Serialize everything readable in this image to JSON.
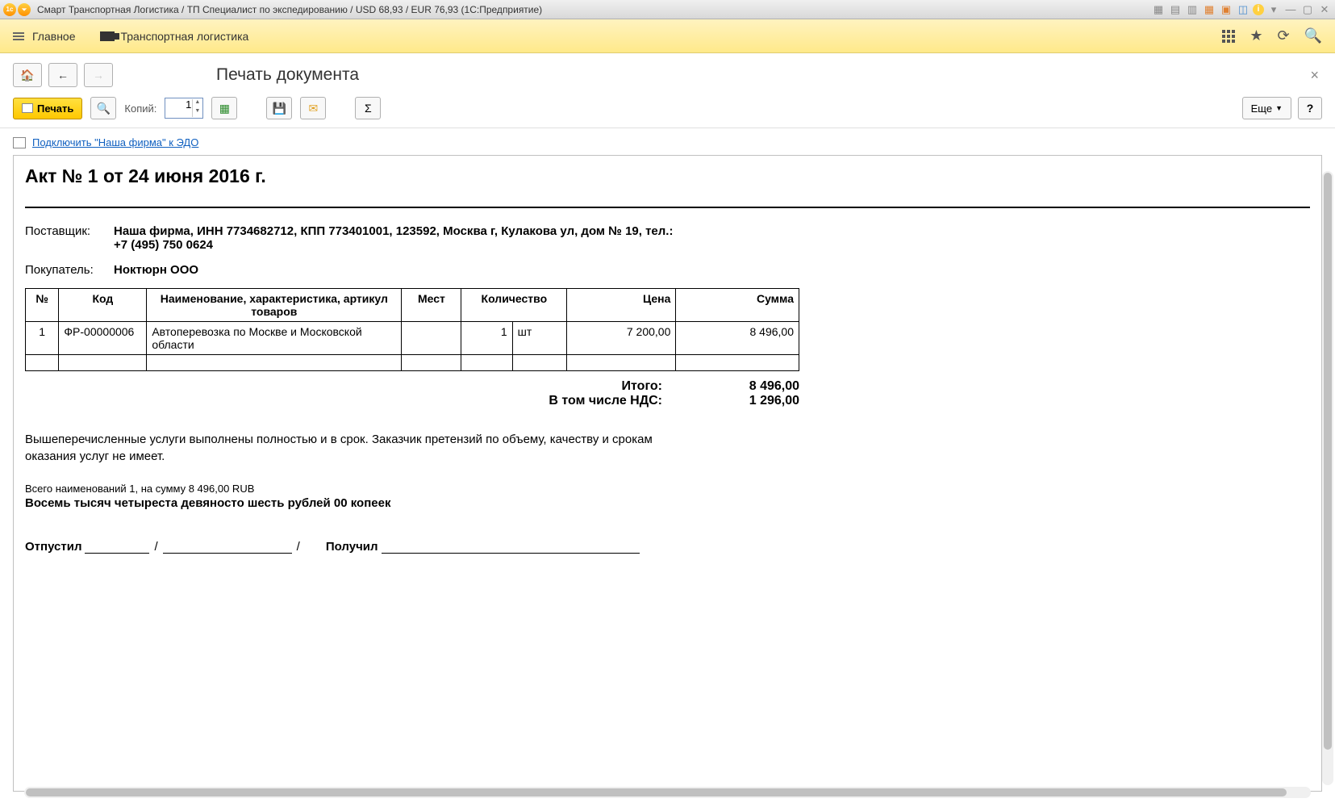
{
  "titlebar": {
    "text": "Смарт Транспортная Логистика / ТП Специалист по экспедированию / USD 68,93 / EUR 76,93  (1С:Предприятие)"
  },
  "menu": {
    "main": "Главное",
    "logistics": "Транспортная логистика"
  },
  "page": {
    "heading": "Печать документа"
  },
  "toolbar": {
    "print": "Печать",
    "copies_label": "Копий:",
    "copies_value": "1",
    "more": "Еще",
    "help": "?"
  },
  "edo": {
    "link": "Подключить \"Наша фирма\" к ЭДО"
  },
  "doc": {
    "title": "Акт № 1 от 24 июня 2016 г.",
    "supplier_label": "Поставщик:",
    "supplier_value": "Наша фирма,  ИНН 7734682712,  КПП 773401001,  123592, Москва г, Кулакова ул, дом № 19,  тел.: +7 (495) 750 0624",
    "buyer_label": "Покупатель:",
    "buyer_value": "Ноктюрн ООО",
    "table": {
      "headers": {
        "num": "№",
        "code": "Код",
        "name": "Наименование, характеристика, артикул товаров",
        "mest": "Мест",
        "qty": "Количество",
        "price": "Цена",
        "sum": "Сумма"
      },
      "rows": [
        {
          "num": "1",
          "code": "ФР-00000006",
          "name": "Автоперевозка по Москве и Московской области",
          "mest": "",
          "qty": "1",
          "unit": "шт",
          "price": "7 200,00",
          "sum": "8 496,00"
        }
      ]
    },
    "totals": {
      "itogo_label": "Итого:",
      "itogo_value": "8 496,00",
      "nds_label": "В том числе НДС:",
      "nds_value": "1 296,00"
    },
    "note": "Вышеперечисленные услуги выполнены полностью и в срок. Заказчик претензий по объему, качеству и срокам оказания услуг не имеет.",
    "summary_small": "Всего наименований 1, на сумму 8 496,00 RUB",
    "summary_words": "Восемь тысяч четыреста девяносто шесть рублей 00 копеек",
    "sign": {
      "otpustil": "Отпустил",
      "poluchil": "Получил"
    }
  }
}
